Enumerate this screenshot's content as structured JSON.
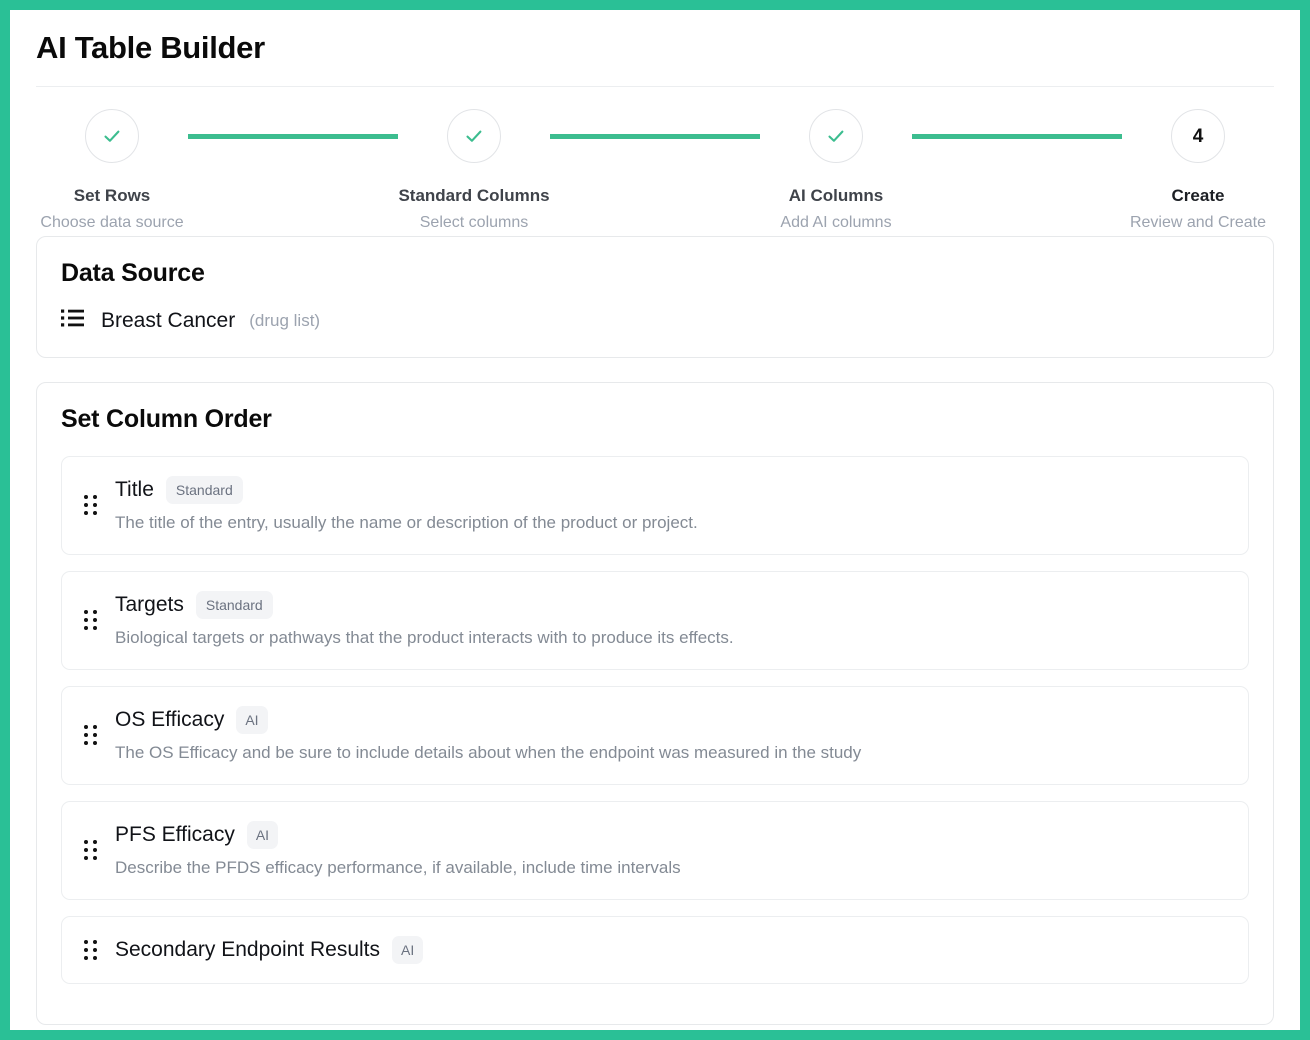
{
  "app": {
    "title": "AI Table Builder",
    "accent_color": "#2ac096",
    "connector_color": "#3cbd8f",
    "check_color": "#3cbd8f"
  },
  "stepper": {
    "steps": [
      {
        "state": "done",
        "marker": "check",
        "label": "Set Rows",
        "sub": "Choose data source"
      },
      {
        "state": "done",
        "marker": "check",
        "label": "Standard Columns",
        "sub": "Select columns"
      },
      {
        "state": "done",
        "marker": "check",
        "label": "AI Columns",
        "sub": "Add AI columns"
      },
      {
        "state": "current",
        "marker": "4",
        "label": "Create",
        "sub": "Review and Create"
      }
    ]
  },
  "data_source": {
    "card_title": "Data Source",
    "icon": "list-icon",
    "name": "Breast Cancer",
    "type": "(drug list)"
  },
  "column_order": {
    "card_title": "Set Column Order",
    "columns": [
      {
        "name": "Title",
        "badge": "Standard",
        "badge_kind": "standard",
        "description": "The title of the entry, usually the name or description of the product or project."
      },
      {
        "name": "Targets",
        "badge": "Standard",
        "badge_kind": "standard",
        "description": "Biological targets or pathways that the product interacts with to produce its effects."
      },
      {
        "name": "OS Efficacy",
        "badge": "AI",
        "badge_kind": "ai",
        "description": "The OS Efficacy and be sure to include details about when the endpoint was measured in the study"
      },
      {
        "name": "PFS Efficacy",
        "badge": "AI",
        "badge_kind": "ai",
        "description": "Describe the PFDS efficacy performance, if available, include time intervals"
      },
      {
        "name": "Secondary Endpoint Results",
        "badge": "AI",
        "badge_kind": "ai",
        "description": ""
      }
    ]
  }
}
